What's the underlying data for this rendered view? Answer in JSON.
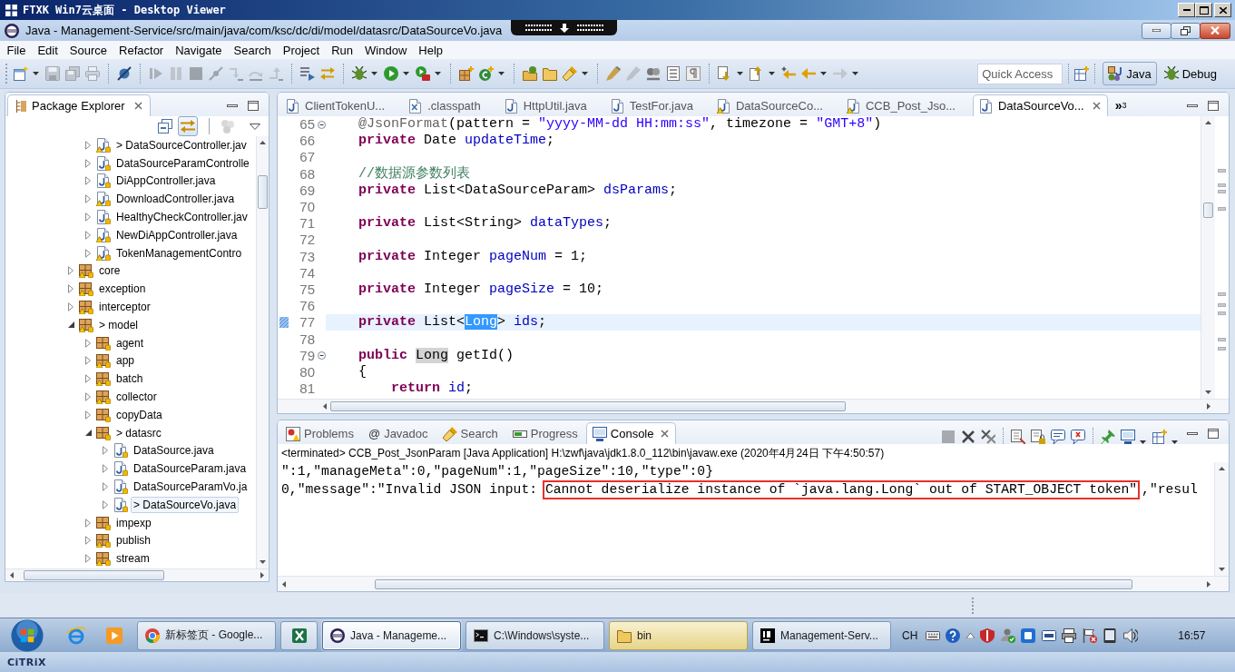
{
  "viewer": {
    "title": "FTXK Win7云桌面 - Desktop Viewer"
  },
  "window": {
    "title": "Java - Management-Service/src/main/java/com/ksc/dc/di/model/datasrc/DataSourceVo.java"
  },
  "menu": [
    "File",
    "Edit",
    "Source",
    "Refactor",
    "Navigate",
    "Search",
    "Project",
    "Run",
    "Window",
    "Help"
  ],
  "toolbar": [
    [
      {
        "kind": "new",
        "disabled": false,
        "dropdown": true
      },
      {
        "kind": "save",
        "disabled": true,
        "dropdown": false
      },
      {
        "kind": "save_all",
        "disabled": true,
        "dropdown": false
      },
      {
        "kind": "print",
        "disabled": true,
        "dropdown": false
      }
    ],
    [
      {
        "kind": "skip_breakpoints",
        "disabled": false,
        "dropdown": false
      }
    ],
    [
      {
        "kind": "resume",
        "disabled": true,
        "dropdown": false
      },
      {
        "kind": "suspend",
        "disabled": true,
        "dropdown": false
      },
      {
        "kind": "terminate",
        "disabled": true,
        "dropdown": false
      },
      {
        "kind": "disconnect",
        "disabled": true,
        "dropdown": false
      },
      {
        "kind": "step_into",
        "disabled": true,
        "dropdown": false
      },
      {
        "kind": "step_over",
        "disabled": true,
        "dropdown": false
      },
      {
        "kind": "step_return",
        "disabled": true,
        "dropdown": false
      }
    ],
    [
      {
        "kind": "step_filters",
        "disabled": false,
        "dropdown": false
      },
      {
        "kind": "swap",
        "disabled": false,
        "dropdown": false
      }
    ],
    [
      {
        "kind": "debug",
        "disabled": false,
        "dropdown": true
      },
      {
        "kind": "run",
        "disabled": false,
        "dropdown": true
      },
      {
        "kind": "external",
        "disabled": false,
        "dropdown": true
      }
    ],
    [
      {
        "kind": "new_package",
        "disabled": false,
        "dropdown": false
      },
      {
        "kind": "new_class",
        "disabled": false,
        "dropdown": true
      }
    ],
    [
      {
        "kind": "open_type",
        "disabled": false,
        "dropdown": false
      },
      {
        "kind": "open_task",
        "disabled": false,
        "dropdown": false
      },
      {
        "kind": "search",
        "disabled": false,
        "dropdown": true
      }
    ],
    [
      {
        "kind": "mark_occurrences",
        "disabled": false,
        "dropdown": false
      },
      {
        "kind": "pen",
        "disabled": true,
        "dropdown": false
      },
      {
        "kind": "block",
        "disabled": false,
        "dropdown": false
      },
      {
        "kind": "list_frame",
        "disabled": false,
        "dropdown": false
      },
      {
        "kind": "pilcrow",
        "disabled": false,
        "dropdown": false
      }
    ],
    [
      {
        "kind": "next_annotation",
        "disabled": false,
        "dropdown": true
      },
      {
        "kind": "prev_annotation",
        "disabled": false,
        "dropdown": true
      },
      {
        "kind": "last_edit",
        "disabled": false,
        "dropdown": false
      },
      {
        "kind": "back",
        "disabled": false,
        "dropdown": true
      },
      {
        "kind": "forward",
        "disabled": true,
        "dropdown": true
      }
    ]
  ],
  "quick_access": {
    "placeholder": "Quick Access"
  },
  "perspectives": [
    {
      "label": "Java",
      "kind": "java",
      "selected": true
    },
    {
      "label": "Debug",
      "kind": "debug",
      "selected": false
    }
  ],
  "package_explorer": {
    "title": "Package Explorer",
    "view_toolbar": [
      {
        "kind": "collapse_all",
        "pressed": false,
        "disabled": false
      },
      {
        "kind": "link_editor",
        "pressed": true,
        "disabled": false
      },
      {
        "kind": "focus",
        "pressed": false,
        "disabled": true
      },
      {
        "kind": "view_menu",
        "pressed": false,
        "disabled": false
      }
    ],
    "items": [
      {
        "children": [
          {
            "label": "> DataSourceController.jav",
            "kind": "java",
            "warning": true,
            "expanded": false,
            "selected": false
          },
          {
            "label": "DataSourceParamControlle",
            "kind": "java",
            "warning": false,
            "expanded": false,
            "selected": false
          },
          {
            "label": "DiAppController.java",
            "kind": "java",
            "warning": false,
            "expanded": false,
            "selected": false
          },
          {
            "label": "DownloadController.java",
            "kind": "java",
            "warning": true,
            "expanded": false,
            "selected": false
          },
          {
            "label": "HealthyCheckController.jav",
            "kind": "java",
            "warning": false,
            "expanded": false,
            "selected": false
          },
          {
            "label": "NewDiAppController.java",
            "kind": "java",
            "warning": true,
            "expanded": false,
            "selected": false
          },
          {
            "label": "TokenManagementContro",
            "kind": "java",
            "warning": true,
            "expanded": false,
            "selected": false
          }
        ]
      },
      {
        "label": "core",
        "kind": "package",
        "warning": true,
        "expanded": false,
        "selected": false
      },
      {
        "label": "exception",
        "kind": "package",
        "warning": true,
        "expanded": false,
        "selected": false
      },
      {
        "label": "interceptor",
        "kind": "package",
        "warning": true,
        "expanded": false,
        "selected": false
      },
      {
        "label": "> model",
        "kind": "package",
        "warning": true,
        "expanded": true,
        "selected": false,
        "children": [
          {
            "label": "agent",
            "kind": "package",
            "warning": false,
            "expanded": false,
            "selected": false
          },
          {
            "label": "app",
            "kind": "package",
            "warning": true,
            "expanded": false,
            "selected": false
          },
          {
            "label": "batch",
            "kind": "package",
            "warning": true,
            "expanded": false,
            "selected": false
          },
          {
            "label": "collector",
            "kind": "package",
            "warning": true,
            "expanded": false,
            "selected": false
          },
          {
            "label": "copyData",
            "kind": "package",
            "warning": false,
            "expanded": false,
            "selected": false
          },
          {
            "label": "> datasrc",
            "kind": "package",
            "warning": false,
            "expanded": true,
            "selected": false,
            "children": [
              {
                "label": "DataSource.java",
                "kind": "java",
                "warning": false,
                "expanded": false,
                "selected": false
              },
              {
                "label": "DataSourceParam.java",
                "kind": "java",
                "warning": false,
                "expanded": false,
                "selected": false
              },
              {
                "label": "DataSourceParamVo.ja",
                "kind": "java",
                "warning": false,
                "expanded": false,
                "selected": false
              },
              {
                "label": "> DataSourceVo.java",
                "kind": "java",
                "warning": false,
                "expanded": false,
                "selected": true
              }
            ]
          },
          {
            "label": "impexp",
            "kind": "package",
            "warning": false,
            "expanded": false,
            "selected": false
          },
          {
            "label": "publish",
            "kind": "package",
            "warning": true,
            "expanded": false,
            "selected": false
          },
          {
            "label": "stream",
            "kind": "package",
            "warning": true,
            "expanded": false,
            "selected": false
          }
        ]
      }
    ]
  },
  "editor": {
    "tabs": [
      {
        "label": "ClientTokenU...",
        "kind": "java",
        "warning": false,
        "selected": false
      },
      {
        "label": ".classpath",
        "kind": "xml",
        "warning": false,
        "selected": false
      },
      {
        "label": "HttpUtil.java",
        "kind": "java",
        "warning": false,
        "selected": false
      },
      {
        "label": "TestFor.java",
        "kind": "java",
        "warning": false,
        "selected": false
      },
      {
        "label": "DataSourceCo...",
        "kind": "java",
        "warning": true,
        "selected": false
      },
      {
        "label": "CCB_Post_Jso...",
        "kind": "java",
        "warning": true,
        "selected": false
      },
      {
        "label": "DataSourceVo...",
        "kind": "java",
        "warning": false,
        "selected": true
      }
    ],
    "overflow": {
      "glyph": "»",
      "count": "3"
    },
    "lines": [
      {
        "number": "65",
        "fold": true,
        "marker": false,
        "current": false,
        "tokens": [
          {
            "kind": "annotation",
            "text": "    @JsonFormat"
          },
          {
            "kind": "plain",
            "text": "(pattern = "
          },
          {
            "kind": "string",
            "text": "\"yyyy-MM-dd HH:mm:ss\""
          },
          {
            "kind": "plain",
            "text": ", timezone = "
          },
          {
            "kind": "string",
            "text": "\"GMT+8\""
          },
          {
            "kind": "plain",
            "text": ")"
          }
        ]
      },
      {
        "number": "66",
        "fold": false,
        "marker": false,
        "current": false,
        "tokens": [
          {
            "kind": "keyword",
            "text": "    private"
          },
          {
            "kind": "plain",
            "text": " Date "
          },
          {
            "kind": "field",
            "text": "updateTime"
          },
          {
            "kind": "plain",
            "text": ";"
          }
        ]
      },
      {
        "number": "67",
        "fold": false,
        "marker": false,
        "current": false
      },
      {
        "number": "68",
        "fold": false,
        "marker": false,
        "current": false,
        "tokens": [
          {
            "kind": "comment",
            "text": "    //数据源参数列表"
          }
        ]
      },
      {
        "number": "69",
        "fold": false,
        "marker": false,
        "current": false,
        "tokens": [
          {
            "kind": "keyword",
            "text": "    private"
          },
          {
            "kind": "plain",
            "text": " List<DataSourceParam> "
          },
          {
            "kind": "field",
            "text": "dsParams"
          },
          {
            "kind": "plain",
            "text": ";"
          }
        ]
      },
      {
        "number": "70",
        "fold": false,
        "marker": false,
        "current": false
      },
      {
        "number": "71",
        "fold": false,
        "marker": false,
        "current": false,
        "tokens": [
          {
            "kind": "keyword",
            "text": "    private"
          },
          {
            "kind": "plain",
            "text": " List<String> "
          },
          {
            "kind": "field",
            "text": "dataTypes"
          },
          {
            "kind": "plain",
            "text": ";"
          }
        ]
      },
      {
        "number": "72",
        "fold": false,
        "marker": false,
        "current": false
      },
      {
        "number": "73",
        "fold": false,
        "marker": false,
        "current": false,
        "tokens": [
          {
            "kind": "keyword",
            "text": "    private"
          },
          {
            "kind": "plain",
            "text": " Integer "
          },
          {
            "kind": "field",
            "text": "pageNum"
          },
          {
            "kind": "plain",
            "text": " = 1;"
          }
        ]
      },
      {
        "number": "74",
        "fold": false,
        "marker": false,
        "current": false
      },
      {
        "number": "75",
        "fold": false,
        "marker": false,
        "current": false,
        "tokens": [
          {
            "kind": "keyword",
            "text": "    private"
          },
          {
            "kind": "plain",
            "text": " Integer "
          },
          {
            "kind": "field",
            "text": "pageSize"
          },
          {
            "kind": "plain",
            "text": " = 10;"
          }
        ]
      },
      {
        "number": "76",
        "fold": false,
        "marker": false,
        "current": false
      },
      {
        "number": "77",
        "fold": false,
        "marker": true,
        "current": true,
        "tokens": [
          {
            "kind": "keyword",
            "text": "    private"
          },
          {
            "kind": "plain",
            "text": " List<"
          },
          {
            "kind": "selection",
            "text": "Long"
          },
          {
            "kind": "plain",
            "text": "> "
          },
          {
            "kind": "field",
            "text": "ids"
          },
          {
            "kind": "plain",
            "text": ";"
          }
        ]
      },
      {
        "number": "78",
        "fold": false,
        "marker": false,
        "current": false
      },
      {
        "number": "79",
        "fold": true,
        "marker": false,
        "current": false,
        "tokens": [
          {
            "kind": "keyword",
            "text": "    public "
          },
          {
            "kind": "occurrence",
            "text": "Long"
          },
          {
            "kind": "plain",
            "text": " getId()"
          }
        ]
      },
      {
        "number": "80",
        "fold": false,
        "marker": false,
        "current": false,
        "tokens": [
          {
            "kind": "plain",
            "text": "    {"
          }
        ]
      },
      {
        "number": "81",
        "fold": false,
        "marker": false,
        "current": false,
        "tokens": [
          {
            "kind": "keyword",
            "text": "        return "
          },
          {
            "kind": "field",
            "text": "id"
          },
          {
            "kind": "plain",
            "text": ";"
          }
        ]
      }
    ]
  },
  "console_view": {
    "tabs": [
      {
        "label": "Problems",
        "kind": "problems",
        "selected": false
      },
      {
        "label": "Javadoc",
        "kind": "javadoc",
        "glyph": "@",
        "selected": false
      },
      {
        "label": "Search",
        "kind": "search",
        "selected": false
      },
      {
        "label": "Progress",
        "kind": "progress",
        "selected": false
      },
      {
        "label": "Console",
        "kind": "console",
        "selected": true
      }
    ],
    "toolbar": [
      [
        {
          "kind": "terminate",
          "disabled": true,
          "dropdown": false
        },
        {
          "kind": "remove",
          "disabled": false,
          "dropdown": false
        },
        {
          "kind": "remove_all",
          "disabled": false,
          "dropdown": false
        }
      ],
      [
        {
          "kind": "clear",
          "disabled": false,
          "dropdown": false
        },
        {
          "kind": "scroll_lock",
          "disabled": false,
          "dropdown": false
        },
        {
          "kind": "show_out",
          "disabled": false,
          "dropdown": false
        },
        {
          "kind": "show_err",
          "disabled": false,
          "dropdown": false
        }
      ],
      [
        {
          "kind": "pin",
          "disabled": false,
          "dropdown": false
        },
        {
          "kind": "display_console",
          "disabled": false,
          "dropdown": true
        },
        {
          "kind": "open_console",
          "disabled": false,
          "dropdown": true
        }
      ]
    ],
    "header": "<terminated> CCB_Post_JsonParam [Java Application] H:\\zwf\\java\\jdk1.8.0_112\\bin\\javaw.exe (2020年4月24日 下午4:50:57)",
    "lines": [
      [
        {
          "text": "\":1,\"manageMeta\":0,\"pageNum\":1,\"pageSize\":10,\"type\":0}",
          "boxed": false
        }
      ],
      [
        {
          "text": "0,\"message\":\"Invalid JSON input: ",
          "boxed": false
        },
        {
          "text": "Cannot deserialize instance of `java.lang.Long` out of START_OBJECT token\"",
          "boxed": true
        },
        {
          "text": ",\"resul",
          "boxed": false
        }
      ]
    ]
  },
  "taskbar": {
    "tasks": [
      {
        "label": "新标签页 - Google...",
        "kind": "chrome",
        "selected": false,
        "flashing": false
      },
      {
        "kind": "excel",
        "selected": false,
        "flashing": false
      },
      {
        "label": "Java - Manageme...",
        "kind": "eclipse",
        "selected": true,
        "flashing": false
      },
      {
        "label": "C:\\Windows\\syste...",
        "kind": "cmd",
        "selected": false,
        "flashing": false
      },
      {
        "label": "bin",
        "kind": "folder",
        "selected": false,
        "flashing": true
      },
      {
        "label": "Management-Serv...",
        "kind": "intellij",
        "selected": false,
        "flashing": false
      }
    ],
    "language": "CH",
    "clock": "16:57"
  },
  "citrix_logo": "CiTRiX"
}
